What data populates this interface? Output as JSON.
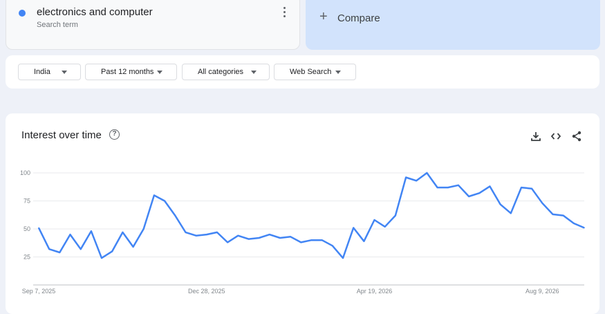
{
  "search_term": {
    "title": "electronics and computer",
    "subtitle": "Search term",
    "dot_color": "#4285f4"
  },
  "compare": {
    "label": "Compare",
    "icon": "plus-icon"
  },
  "filters": {
    "region": "India",
    "time_range": "Past 12 months",
    "category": "All categories",
    "search_type": "Web Search"
  },
  "chart_section": {
    "title": "Interest over time",
    "icons": [
      "help-icon",
      "download-icon",
      "embed-icon",
      "share-icon"
    ]
  },
  "chart_data": {
    "type": "line",
    "ylim": [
      0,
      100
    ],
    "yticks": [
      25,
      50,
      75,
      100
    ],
    "x_tick_labels": [
      {
        "label": "Sep 7, 2025",
        "index": 0
      },
      {
        "label": "Dec 28, 2025",
        "index": 16
      },
      {
        "label": "Apr 19, 2026",
        "index": 32
      },
      {
        "label": "Aug 9, 2026",
        "index": 48
      }
    ],
    "line_color": "#4285f4",
    "values": [
      51,
      32,
      29,
      45,
      32,
      48,
      24,
      30,
      47,
      34,
      50,
      80,
      75,
      62,
      47,
      44,
      45,
      47,
      38,
      44,
      41,
      42,
      45,
      42,
      43,
      38,
      40,
      40,
      35,
      24,
      51,
      39,
      58,
      52,
      62,
      96,
      93,
      100,
      87,
      87,
      89,
      79,
      82,
      88,
      72,
      64,
      87,
      86,
      73,
      63,
      62,
      55,
      51
    ]
  }
}
